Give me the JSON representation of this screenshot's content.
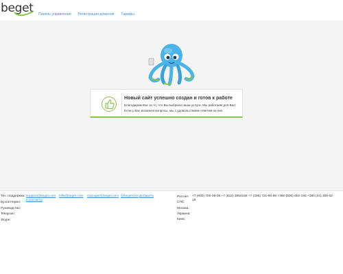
{
  "header": {
    "logo_text": "beget",
    "nav": [
      {
        "label": "Панель управления"
      },
      {
        "label": "Регистрация доменов"
      },
      {
        "label": "Тарифы"
      }
    ]
  },
  "card": {
    "title": "Новый сайт успешно создан и готов к работе",
    "line1": "Благодарим Вас за то, что Вы выбрали наши услуги. Мы работаем для Вас!",
    "line2": "Если у Вас возникли вопросы, мы с удовольствием ответим на них."
  },
  "footer": {
    "left": {
      "support_label": "Тех. поддержка:",
      "support_email": "support@beget.com",
      "billing_email": "bills@beget.com",
      "manager_email": "manager@beget.com",
      "skype_handle": "@begetcom",
      "add_contacts": "Добавить",
      "add_contacts2": "в контакты",
      "accounting_label": "Бухгалтерия:",
      "management_label": "Руководство:",
      "telegram_label": "Telegram:",
      "skype_label": "Skype:"
    },
    "right": {
      "russia_label": "Россия:",
      "spb_label": "СПб:",
      "russia_phones": "+7 (800) 700-06-08  +7 (812) 3854156  +7 (495) 721-80-88  +380 (800) 802-192  +380 (44) 300-02-",
      "russia_phones_cont": "18",
      "moscow_label": "Москва:",
      "ukraine_label": "Украина:",
      "kiev_label": "Киев:"
    }
  },
  "colors": {
    "link": "#3c8fd1",
    "accent_green": "#8bc34a",
    "mascot_blue": "#4ab3e8",
    "background": "#f4f4f4"
  }
}
